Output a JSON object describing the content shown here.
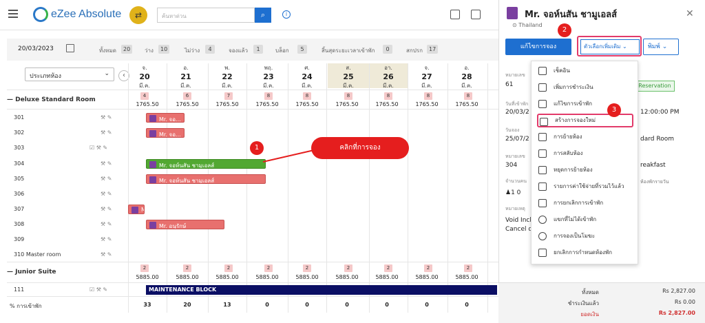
{
  "app": {
    "brand": "eZee Absolute",
    "search_placeholder": "ค้นหาด่วน"
  },
  "stats": {
    "date": "20/03/2023",
    "items": [
      {
        "label": "ทั้งหมด",
        "count": "20"
      },
      {
        "label": "ว่าง",
        "count": "10"
      },
      {
        "label": "ไม่ว่าง",
        "count": "4"
      },
      {
        "label": "จองแล้ว",
        "count": "1"
      },
      {
        "label": "บล็อก",
        "count": "5"
      },
      {
        "label": "สิ้นสุดระยะเวลาเข้าพัก",
        "count": "0"
      },
      {
        "label": "สกปรก",
        "count": "17"
      }
    ]
  },
  "grid": {
    "room_type_select": "ประเภทห้อง",
    "days": [
      {
        "dow": "จ.",
        "num": "20",
        "mon": "มี.ค."
      },
      {
        "dow": "อ.",
        "num": "21",
        "mon": "มี.ค."
      },
      {
        "dow": "พ.",
        "num": "22",
        "mon": "มี.ค."
      },
      {
        "dow": "พฤ.",
        "num": "23",
        "mon": "มี.ค."
      },
      {
        "dow": "ศ.",
        "num": "24",
        "mon": "มี.ค."
      },
      {
        "dow": "ส.",
        "num": "25",
        "mon": "มี.ค."
      },
      {
        "dow": "อา.",
        "num": "26",
        "mon": "มี.ค."
      },
      {
        "dow": "จ.",
        "num": "27",
        "mon": "มี.ค."
      },
      {
        "dow": "อ.",
        "num": "28",
        "mon": "มี.ค."
      }
    ],
    "sections": [
      {
        "name": "Deluxe Standard Room",
        "counts": [
          "4",
          "6",
          "7",
          "8",
          "8",
          "8",
          "8",
          "8",
          "8"
        ],
        "rate": "1765.50",
        "rooms": [
          "301",
          "302",
          "303",
          "304",
          "305",
          "306",
          "307",
          "308",
          "309",
          "310 Master room"
        ]
      },
      {
        "name": "Junior Suite",
        "counts": [
          "2",
          "2",
          "2",
          "2",
          "2",
          "2",
          "2",
          "2",
          "2"
        ],
        "rate": "5885.00",
        "rooms": [
          "111"
        ]
      }
    ],
    "occupancy_label": "% การเข้าพัก",
    "occupancy": [
      "33",
      "20",
      "13",
      "0",
      "0",
      "0",
      "0",
      "0",
      "0"
    ],
    "bookings": {
      "b301": "Mr. จอ...",
      "b302": "Mr. จอ...",
      "b304": "Mr. จอห์นสัน ชามูเอลส์",
      "b305": "Mr. จอห์นสัน ชามูเอลส์",
      "b307": "M",
      "b308": "Mr. อนุรักษ์",
      "maint": "MAINTENANCE BLOCK"
    },
    "callout": "คลิกที่การจอง"
  },
  "panel": {
    "title": "Mr. จอห์นสัน ชามูเอลส์",
    "location": "Thailand",
    "btn_edit": "แก้ไขการจอง",
    "btn_more": "ตัวเลือกเพิ่มเติม",
    "btn_print": "พิมพ์",
    "res_no_label": "หมายเลข",
    "res_no": "61",
    "status_badge": "Reservation",
    "checkin_label": "วันที่เข้าพัก",
    "checkin": "20/03/2",
    "checkin_time": "12:00:00 PM",
    "booked_label": "วันจอง",
    "booked": "25/07/2",
    "room_type_tail": "dard Room",
    "room_no_label": "หมายเลข",
    "room_no": "304",
    "rate_type_tail": "reakfast",
    "guests_label": "จำนวนคน",
    "guests": "1  0",
    "daily_tail": "ห้องพักรายวัน",
    "note_label": "หมายเหตุ",
    "note1": "Void Incl",
    "note2": "Cancel d",
    "totals": [
      {
        "label": "ทั้งหมด",
        "value": "Rs 2,827.00"
      },
      {
        "label": "ชำระเงินแล้ว",
        "value": "Rs 0.00"
      },
      {
        "label": "ยอดเงิน",
        "value": "Rs 2,827.00"
      }
    ]
  },
  "dropdown": [
    "เช็คอิน",
    "เพิ่มการชำระเงิน",
    "แก้ไขการเข้าพัก",
    "สร้างการจองใหม่",
    "การย้ายห้อง",
    "การสลับห้อง",
    "หยุดการย้ายห้อง",
    "รายการค่าใช้จ่ายที่รวมไว้แล้ว",
    "การยกเลิกการเข้าพัก",
    "แขกที่ไม่ได้เข้าพัก",
    "การจองเป็นโมฆะ",
    "ยกเลิกการกำหนดห้องพัก"
  ],
  "steps": [
    "1",
    "2",
    "3"
  ]
}
